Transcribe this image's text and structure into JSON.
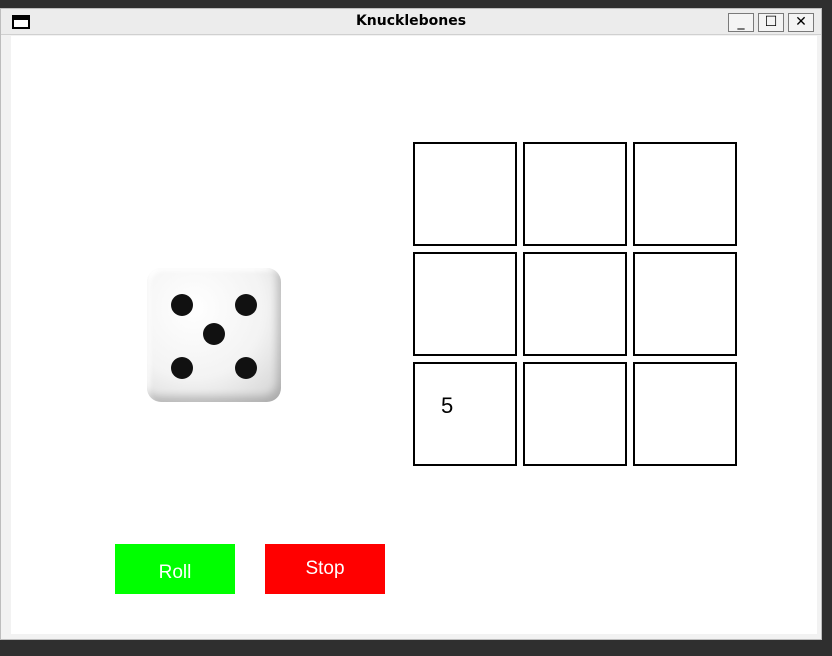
{
  "window": {
    "title": "Knucklebones",
    "minimize_label": "_",
    "maximize_label": "☐",
    "close_label": "✕"
  },
  "die": {
    "value": 5,
    "icon": "die-five-icon"
  },
  "board": {
    "cells": [
      "",
      "",
      "",
      "",
      "",
      "",
      "5",
      "",
      ""
    ]
  },
  "buttons": {
    "roll_label": "Roll",
    "stop_label": "Stop"
  },
  "colors": {
    "roll": "#00ff00",
    "stop": "#ff0000"
  }
}
